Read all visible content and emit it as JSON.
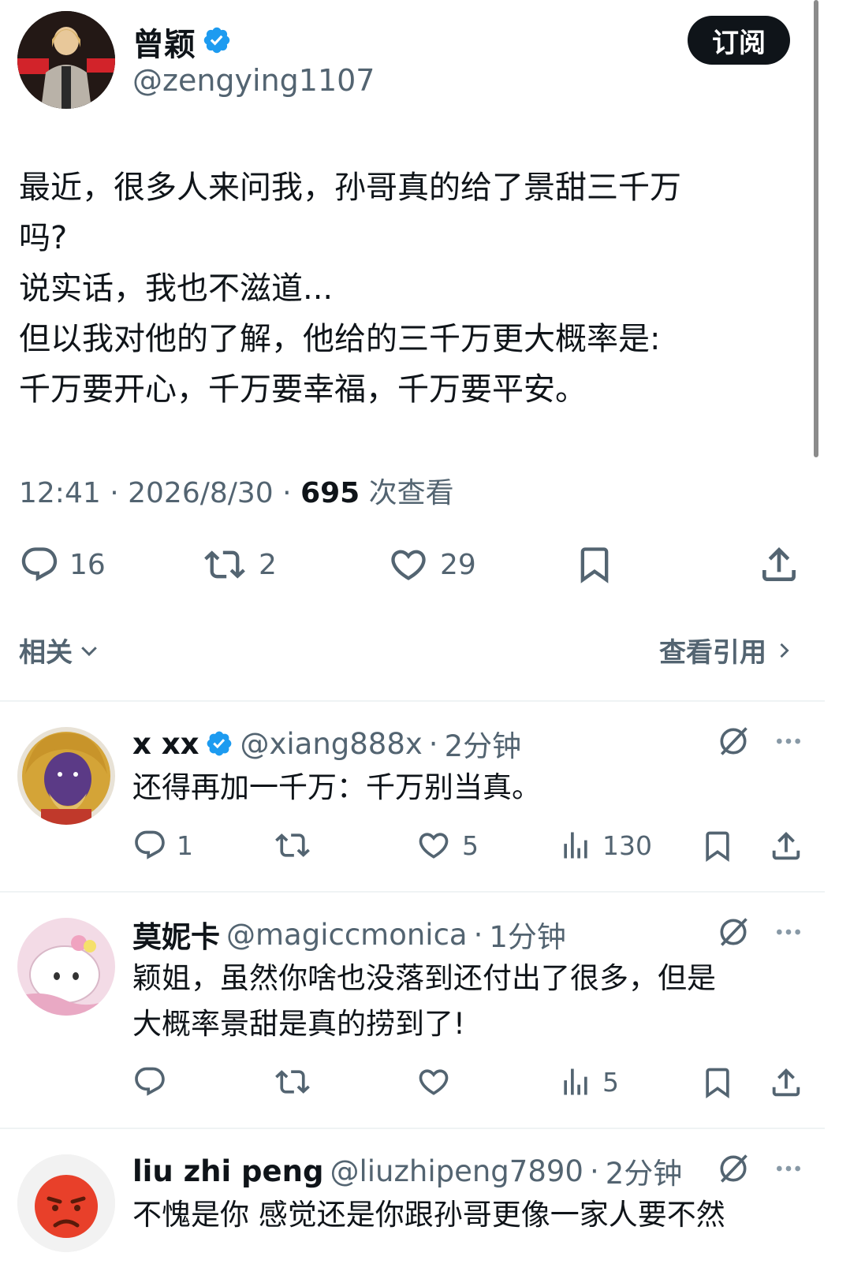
{
  "main_tweet": {
    "author_name": "曾颖",
    "handle": "@zengying1107",
    "subscribe_label": "订阅",
    "text": "最近，很多人来问我，孙哥真的给了景甜三千万\n吗?\n说实话，我也不滋道...\n但以我对他的了解，他给的三千万更大概率是:\n千万要开心，千万要幸福，千万要平安。",
    "time": "12:41",
    "date": "2026/8/30",
    "views_count": "695",
    "views_label": "次查看",
    "replies": "16",
    "retweets": "2",
    "likes": "29"
  },
  "related": {
    "label": "相关",
    "quotes_label": "查看引用"
  },
  "replies": [
    {
      "name": "x xx",
      "handle": "@xiang888x",
      "time": "2分钟",
      "text": "还得再加一千万：千万别当真。",
      "replies": "1",
      "retweets": "",
      "likes": "5",
      "views": "130"
    },
    {
      "name": "莫妮卡",
      "handle": "@magiccmonica",
      "time": "1分钟",
      "text": "颖姐，虽然你啥也没落到还付出了很多，但是\n大概率景甜是真的捞到了!",
      "replies": "",
      "retweets": "",
      "likes": "",
      "views": "5"
    },
    {
      "name": "liu zhi peng",
      "handle": "@liuzhipeng7890",
      "time": "2分钟",
      "text": "不愧是你 感觉还是你跟孙哥更像一家人要不然"
    }
  ],
  "colors": {
    "verified_blue": "#1d9bf0",
    "text_primary": "#0f1419",
    "text_secondary": "#536471"
  },
  "icons": [
    "verified-icon",
    "reply-icon",
    "retweet-icon",
    "like-icon",
    "bookmark-icon",
    "share-icon",
    "views-icon",
    "grok-icon",
    "more-icon",
    "chevron-down-icon",
    "chevron-right-icon"
  ]
}
